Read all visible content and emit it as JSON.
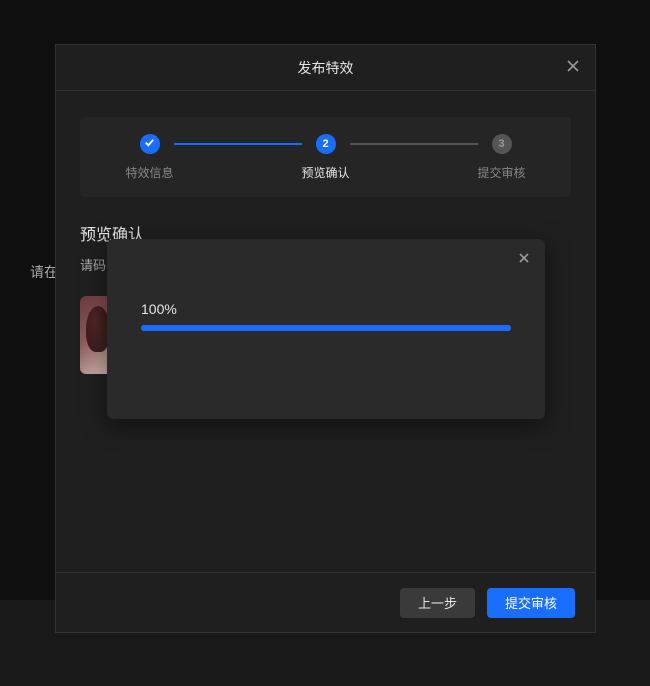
{
  "background": {
    "partial_text": "请在"
  },
  "main_dialog": {
    "title": "发布特效",
    "steps": [
      {
        "label": "特效信息",
        "num": "1"
      },
      {
        "label": "预览确认",
        "num": "2"
      },
      {
        "label": "提交审核",
        "num": "3"
      }
    ],
    "section": {
      "title": "预览确认",
      "sub_partial": "请码"
    },
    "buttons": {
      "prev": "上一步",
      "submit": "提交审核"
    }
  },
  "progress": {
    "percent_label": "100%",
    "percent": 100
  }
}
